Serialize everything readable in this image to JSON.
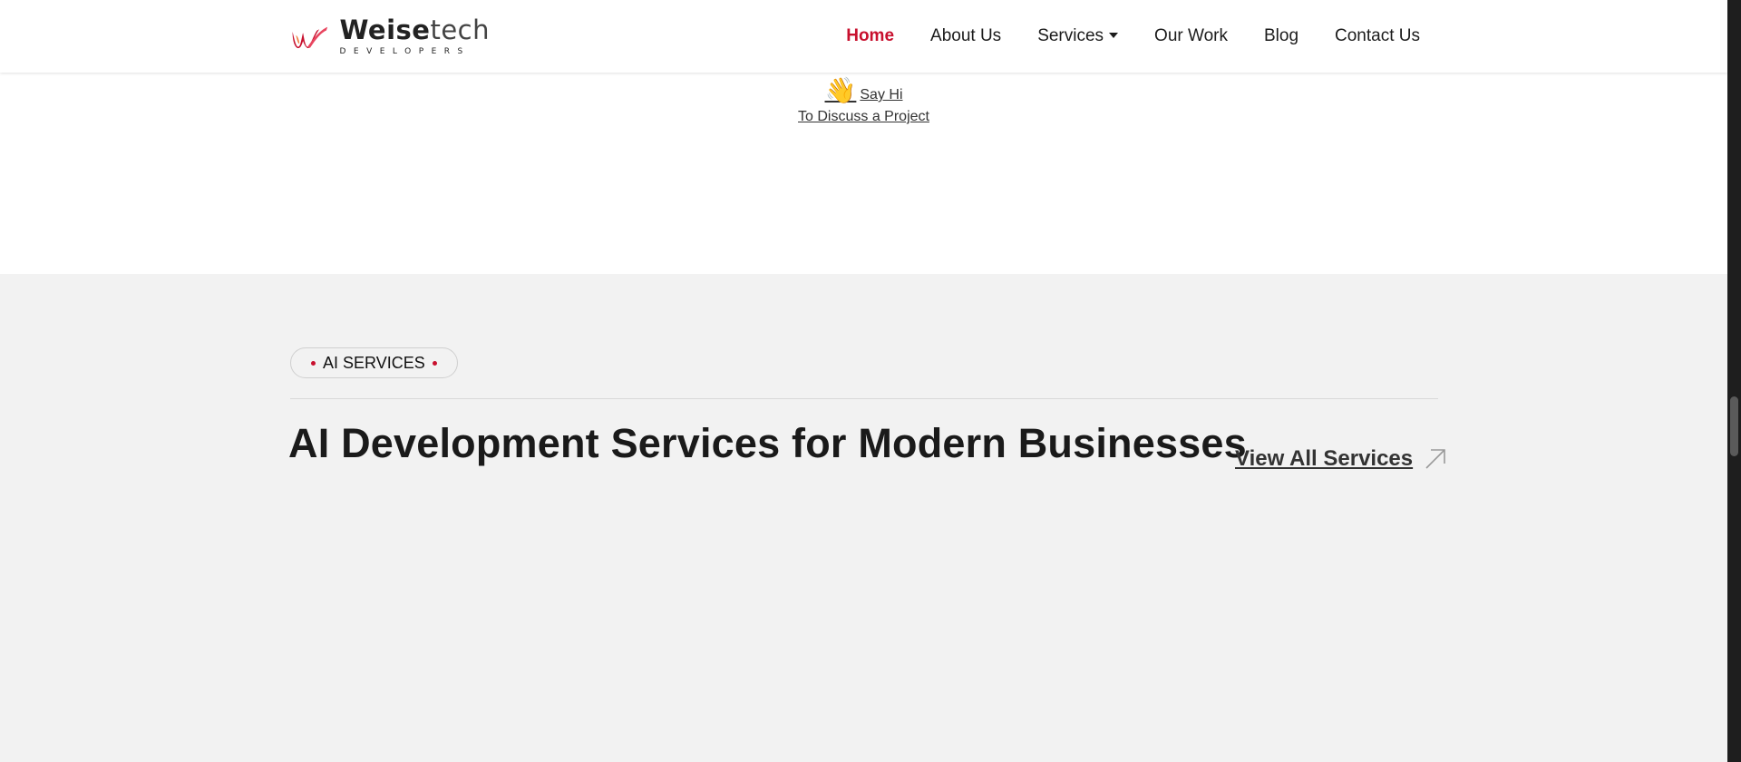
{
  "header": {
    "logo": {
      "name_bold": "Weise",
      "name_light": "tech",
      "tagline": "DEVELOPERS",
      "icon": "weisetech-logo-mark"
    },
    "nav": [
      {
        "label": "Home",
        "active": true
      },
      {
        "label": "About Us",
        "active": false
      },
      {
        "label": "Services",
        "active": false,
        "dropdown": true
      },
      {
        "label": "Our Work",
        "active": false
      },
      {
        "label": "Blog",
        "active": false
      },
      {
        "label": "Contact Us",
        "active": false
      }
    ]
  },
  "hero": {
    "wave_emoji": "👋",
    "say_hi": "Say Hi",
    "discuss": "To Discuss a Project"
  },
  "services": {
    "badge": "AI SERVICES",
    "title": "AI Development Services for Modern Businesses",
    "view_all": "View All Services",
    "arrow_icon": "arrow-up-right-icon"
  },
  "colors": {
    "accent": "#c8102e",
    "section_bg": "#f2f2f2",
    "header_bg": "#ffffff",
    "text": "#1a1a1a"
  }
}
